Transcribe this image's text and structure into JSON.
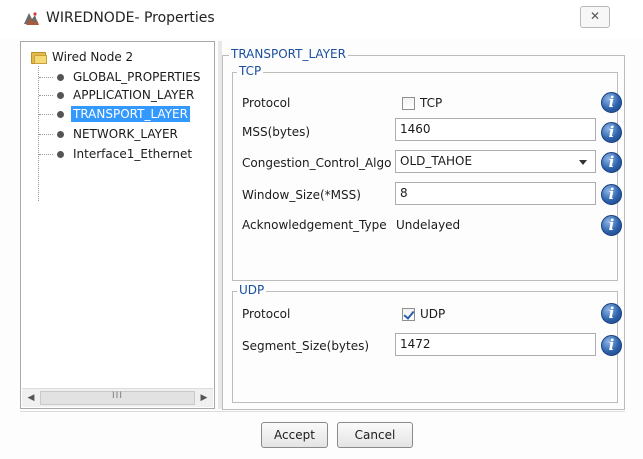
{
  "window": {
    "title": "WIREDNODE- Properties",
    "close_glyph": "✕"
  },
  "tree": {
    "root_label": "Wired Node 2",
    "items": [
      {
        "label": "GLOBAL_PROPERTIES",
        "selected": false
      },
      {
        "label": "APPLICATION_LAYER",
        "selected": false
      },
      {
        "label": "TRANSPORT_LAYER",
        "selected": true
      },
      {
        "label": "NETWORK_LAYER",
        "selected": false
      },
      {
        "label": "Interface1_Ethernet",
        "selected": false
      }
    ],
    "scroll_left": "◀",
    "scroll_right": "▶",
    "scroll_grip": "III"
  },
  "transport": {
    "title": "TRANSPORT_LAYER",
    "tcp": {
      "title": "TCP",
      "protocol_label": "Protocol",
      "protocol_checkbox_label": "TCP",
      "protocol_checked": false,
      "mss_label": "MSS(bytes)",
      "mss_value": "1460",
      "congestion_label": "Congestion_Control_Algo",
      "congestion_value": "OLD_TAHOE",
      "window_size_label": "Window_Size(*MSS)",
      "window_size_value": "8",
      "ack_label": "Acknowledgement_Type",
      "ack_value": "Undelayed"
    },
    "udp": {
      "title": "UDP",
      "protocol_label": "Protocol",
      "protocol_checkbox_label": "UDP",
      "protocol_checked": true,
      "segment_label": "Segment_Size(bytes)",
      "segment_value": "1472"
    },
    "info_glyph": "i"
  },
  "buttons": {
    "accept": "Accept",
    "cancel": "Cancel"
  },
  "colors": {
    "selection": "#3399ff",
    "legend_text": "#1a4fa0",
    "info_icon": "#2d63ad"
  }
}
